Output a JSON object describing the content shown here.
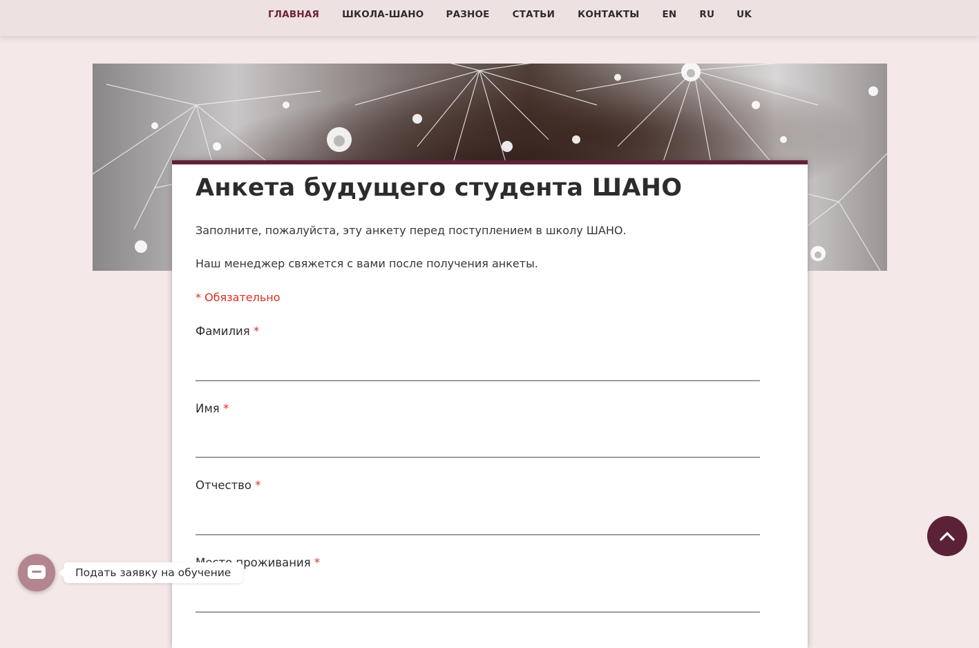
{
  "nav": {
    "items": [
      {
        "label": "ГЛАВНАЯ",
        "active": true
      },
      {
        "label": "ШКОЛА-ШАНО",
        "active": false
      },
      {
        "label": "РАЗНОЕ",
        "active": false
      },
      {
        "label": "СТАТЬИ",
        "active": false
      },
      {
        "label": "КОНТАКТЫ",
        "active": false
      },
      {
        "label": "EN",
        "active": false
      },
      {
        "label": "RU",
        "active": false
      },
      {
        "label": "UK",
        "active": false
      }
    ]
  },
  "form": {
    "title": "Анкета будущего студента ШАНО",
    "description_1": "Заполните, пожалуйста, эту анкету перед поступлением в школу ШАНО.",
    "description_2": "Наш менеджер свяжется с вами после получения анкеты.",
    "required_note": "* Обязательно",
    "required_marker": "*",
    "fields": [
      {
        "label": "Фамилия",
        "value": ""
      },
      {
        "label": "Имя",
        "value": ""
      },
      {
        "label": "Отчество",
        "value": ""
      },
      {
        "label": "Место проживания",
        "value": ""
      }
    ]
  },
  "chat": {
    "label": "Подать заявку на обучение",
    "icon": "chat-bubble-icon"
  },
  "scroll_top": {
    "icon": "chevron-up-icon"
  },
  "colors": {
    "accent": "#5e2338",
    "active_nav": "#6b2338",
    "required": "#d93025",
    "chat_button": "#b3858f",
    "background": "#f4e8e9"
  }
}
